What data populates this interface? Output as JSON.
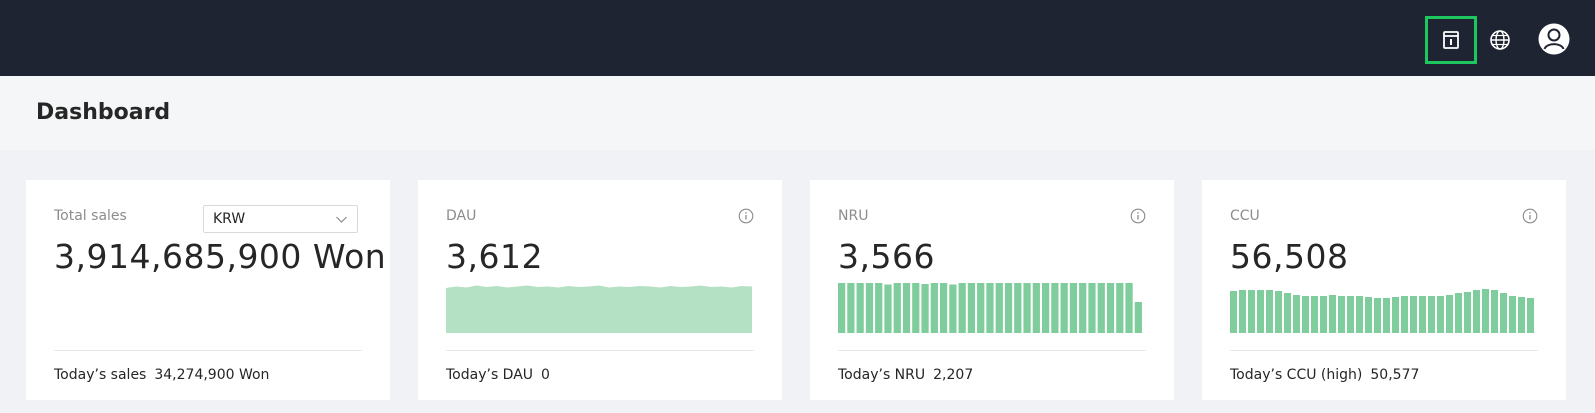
{
  "topbar": {
    "icons": [
      "document-info-icon",
      "globe-icon",
      "user-avatar-icon"
    ]
  },
  "page": {
    "title": "Dashboard"
  },
  "colors": {
    "topbar": "#1f2432",
    "accent": "#1ec75e",
    "chart_fill": "#b4e0c4",
    "bar_fill": "#7fcc9c"
  },
  "cards": {
    "sales": {
      "label": "Total sales",
      "currency": "KRW",
      "value": "3,914,685,900 Won",
      "footer_label": "Today’s sales",
      "footer_value": "34,274,900 Won"
    },
    "dau": {
      "label": "DAU",
      "value": "3,612",
      "footer_label": "Today’s DAU",
      "footer_value": "0"
    },
    "nru": {
      "label": "NRU",
      "value": "3,566",
      "footer_label": "Today’s NRU",
      "footer_value": "2,207"
    },
    "ccu": {
      "label": "CCU",
      "value": "56,508",
      "footer_label": "Today’s CCU (high)",
      "footer_value": "50,577"
    }
  },
  "chart_data": [
    {
      "type": "area",
      "name": "dau-trend",
      "values": [
        0.9,
        0.93,
        0.91,
        0.95,
        0.92,
        0.94,
        0.91,
        0.93,
        0.95,
        0.92,
        0.93,
        0.91,
        0.94,
        0.92,
        0.93,
        0.95,
        0.91,
        0.93,
        0.92,
        0.94,
        0.93,
        0.91,
        0.94,
        0.92,
        0.93,
        0.95,
        0.92,
        0.93,
        0.91,
        0.94,
        0.93
      ],
      "ylim": [
        0,
        1
      ]
    },
    {
      "type": "bar",
      "name": "nru-trend",
      "values": [
        1.0,
        1.0,
        1.0,
        1.0,
        1.0,
        0.97,
        1.0,
        1.0,
        1.0,
        0.98,
        1.0,
        1.0,
        0.97,
        1.0,
        1.0,
        1.0,
        1.0,
        1.0,
        1.0,
        1.0,
        1.0,
        1.0,
        1.0,
        1.0,
        1.0,
        1.0,
        1.0,
        1.0,
        1.0,
        1.0,
        1.0,
        1.0,
        0.62
      ],
      "ylim": [
        0,
        1
      ]
    },
    {
      "type": "bar",
      "name": "ccu-trend",
      "values": [
        0.84,
        0.86,
        0.86,
        0.86,
        0.86,
        0.84,
        0.8,
        0.76,
        0.74,
        0.74,
        0.74,
        0.76,
        0.74,
        0.74,
        0.74,
        0.72,
        0.7,
        0.7,
        0.72,
        0.74,
        0.74,
        0.74,
        0.74,
        0.74,
        0.76,
        0.8,
        0.82,
        0.86,
        0.88,
        0.86,
        0.8,
        0.74,
        0.72,
        0.7
      ],
      "ylim": [
        0,
        1
      ]
    }
  ]
}
